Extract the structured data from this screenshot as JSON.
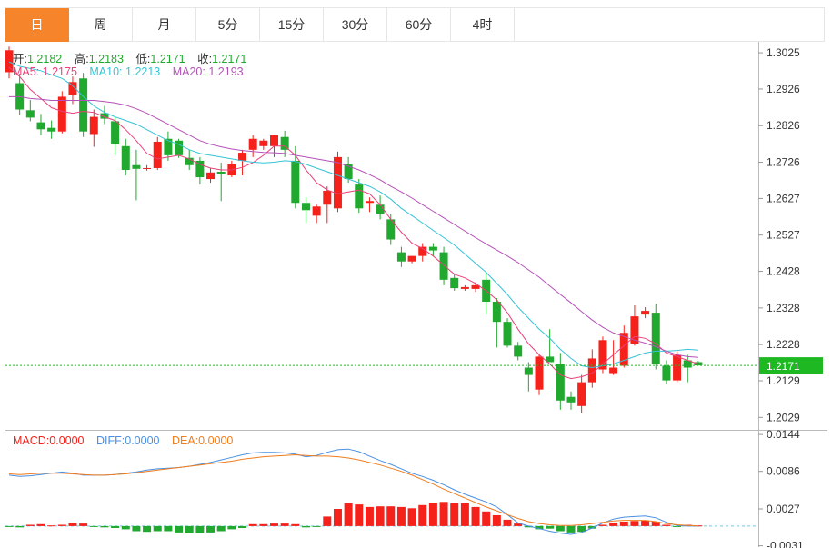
{
  "tabs": [
    "日",
    "周",
    "月",
    "5分",
    "15分",
    "30分",
    "60分",
    "4时"
  ],
  "active_tab": 0,
  "ohlc_info": {
    "open_label": "开:",
    "open": "1.2182",
    "high_label": "高:",
    "high": "1.2183",
    "low_label": "低:",
    "low": "1.2171",
    "close_label": "收:",
    "close": "1.2171"
  },
  "ma_info": {
    "ma5_label": "MA5:",
    "ma5": "1.2175",
    "ma10_label": "MA10:",
    "ma10": "1.2213",
    "ma20_label": "MA20:",
    "ma20": "1.2193"
  },
  "macd_info": {
    "macd_label": "MACD:",
    "macd": "0.0000",
    "diff_label": "DIFF:",
    "diff": "0.0000",
    "dea_label": "DEA:",
    "dea": "0.0000"
  },
  "colors": {
    "up": "#f5211b",
    "down": "#21a82f",
    "ma5": "#e9407a",
    "ma10": "#36c3d6",
    "ma20": "#b451b8",
    "diff": "#4a90e2",
    "dea": "#f07d1e",
    "price_tag": "#1db822",
    "accent": "#f5842b"
  },
  "chart_data": [
    {
      "type": "candlestick",
      "y_ticks": [
        "1.3025",
        "1.2926",
        "1.2826",
        "1.2726",
        "1.2627",
        "1.2527",
        "1.2428",
        "1.2328",
        "1.2228",
        "1.2129",
        "1.2029"
      ],
      "ylim": [
        1.1995,
        1.3055
      ],
      "last_price": "1.2171",
      "candles": [
        [
          1.2972,
          1.3042,
          1.2955,
          1.3032
        ],
        [
          1.2942,
          1.2968,
          1.2855,
          1.287
        ],
        [
          1.2868,
          1.2896,
          1.2838,
          1.2848
        ],
        [
          1.2835,
          1.2858,
          1.28,
          1.2816
        ],
        [
          1.282,
          1.284,
          1.279,
          1.281
        ],
        [
          1.281,
          1.292,
          1.2805,
          1.2905
        ],
        [
          1.291,
          1.296,
          1.2885,
          1.2945
        ],
        [
          1.2955,
          1.297,
          1.2795,
          1.281
        ],
        [
          1.2803,
          1.287,
          1.2768,
          1.285
        ],
        [
          1.286,
          1.288,
          1.283,
          1.2845
        ],
        [
          1.2838,
          1.285,
          1.2745,
          1.2775
        ],
        [
          1.277,
          1.279,
          1.269,
          1.2705
        ],
        [
          1.2718,
          1.276,
          1.2622,
          1.2708
        ],
        [
          1.2708,
          1.2718,
          1.2703,
          1.271
        ],
        [
          1.271,
          1.2795,
          1.2705,
          1.2782
        ],
        [
          1.279,
          1.281,
          1.273,
          1.2745
        ],
        [
          1.2785,
          1.279,
          1.2738,
          1.2745
        ],
        [
          1.2738,
          1.276,
          1.2705,
          1.2718
        ],
        [
          1.273,
          1.274,
          1.2665,
          1.2685
        ],
        [
          1.268,
          1.271,
          1.267,
          1.2698
        ],
        [
          1.27,
          1.2725,
          1.262,
          1.2695
        ],
        [
          1.269,
          1.273,
          1.2685,
          1.272
        ],
        [
          1.273,
          1.276,
          1.269,
          1.2752
        ],
        [
          1.276,
          1.28,
          1.274,
          1.279
        ],
        [
          1.277,
          1.279,
          1.276,
          1.2785
        ],
        [
          1.277,
          1.28,
          1.274,
          1.28
        ],
        [
          1.2795,
          1.2812,
          1.274,
          1.276
        ],
        [
          1.273,
          1.277,
          1.26,
          1.2615
        ],
        [
          1.2615,
          1.263,
          1.256,
          1.2595
        ],
        [
          1.258,
          1.261,
          1.256,
          1.2605
        ],
        [
          1.261,
          1.266,
          1.256,
          1.2648
        ],
        [
          1.26,
          1.2755,
          1.259,
          1.274
        ],
        [
          1.272,
          1.274,
          1.267,
          1.268
        ],
        [
          1.2665,
          1.268,
          1.2588,
          1.26
        ],
        [
          1.2615,
          1.263,
          1.259,
          1.262
        ],
        [
          1.261,
          1.2635,
          1.257,
          1.2585
        ],
        [
          1.257,
          1.2585,
          1.25,
          1.2515
        ],
        [
          1.248,
          1.2495,
          1.244,
          1.2455
        ],
        [
          1.2455,
          1.247,
          1.245,
          1.247
        ],
        [
          1.247,
          1.2505,
          1.2455,
          1.2495
        ],
        [
          1.2495,
          1.2505,
          1.247,
          1.2485
        ],
        [
          1.248,
          1.2495,
          1.239,
          1.2405
        ],
        [
          1.241,
          1.242,
          1.2375,
          1.2382
        ],
        [
          1.238,
          1.239,
          1.2375,
          1.2385
        ],
        [
          1.238,
          1.2398,
          1.2372,
          1.239
        ],
        [
          1.2405,
          1.2425,
          1.231,
          1.2345
        ],
        [
          1.2345,
          1.2355,
          1.222,
          1.229
        ],
        [
          1.229,
          1.23,
          1.222,
          1.2225
        ],
        [
          1.2225,
          1.2235,
          1.2185,
          1.2195
        ],
        [
          1.2165,
          1.218,
          1.21,
          1.2145
        ],
        [
          1.2105,
          1.22,
          1.209,
          1.2195
        ],
        [
          1.2195,
          1.227,
          1.2182,
          1.218
        ],
        [
          1.2175,
          1.2205,
          1.205,
          1.2075
        ],
        [
          1.2085,
          1.21,
          1.205,
          1.207
        ],
        [
          1.206,
          1.2145,
          1.204,
          1.2125
        ],
        [
          1.2125,
          1.2215,
          1.211,
          1.219
        ],
        [
          1.216,
          1.225,
          1.215,
          1.224
        ],
        [
          1.215,
          1.224,
          1.2145,
          1.2165
        ],
        [
          1.217,
          1.228,
          1.2165,
          1.226
        ],
        [
          1.223,
          1.2335,
          1.2225,
          1.2305
        ],
        [
          1.231,
          1.233,
          1.23,
          1.232
        ],
        [
          1.2315,
          1.234,
          1.216,
          1.2175
        ],
        [
          1.217,
          1.2185,
          1.212,
          1.213
        ],
        [
          1.213,
          1.221,
          1.2125,
          1.22
        ],
        [
          1.2185,
          1.22,
          1.2125,
          1.2165
        ],
        [
          1.218,
          1.2183,
          1.2171,
          1.2171
        ]
      ],
      "ma5": [
        1.2985,
        1.296,
        1.2925,
        1.29,
        1.2875,
        1.2865,
        1.286,
        1.2865,
        1.2862,
        1.285,
        1.284,
        1.2815,
        1.2785,
        1.275,
        1.2735,
        1.274,
        1.2745,
        1.2735,
        1.272,
        1.271,
        1.2705,
        1.2705,
        1.2712,
        1.2725,
        1.2745,
        1.277,
        1.277,
        1.2745,
        1.2705,
        1.267,
        1.265,
        1.264,
        1.2645,
        1.265,
        1.264,
        1.261,
        1.257,
        1.2535,
        1.2505,
        1.249,
        1.247,
        1.2445,
        1.242,
        1.241,
        1.2395,
        1.2375,
        1.235,
        1.2315,
        1.227,
        1.223,
        1.22,
        1.2175,
        1.2145,
        1.2135,
        1.214,
        1.215,
        1.2175,
        1.22,
        1.2225,
        1.225,
        1.2245,
        1.223,
        1.2205,
        1.2195,
        1.2185,
        1.2175
      ],
      "ma10": [
        1.3,
        1.2988,
        1.2982,
        1.2976,
        1.2965,
        1.2955,
        1.2935,
        1.2905,
        1.288,
        1.2862,
        1.285,
        1.284,
        1.283,
        1.2815,
        1.28,
        1.2785,
        1.2775,
        1.276,
        1.275,
        1.2745,
        1.274,
        1.2735,
        1.273,
        1.2726,
        1.2724,
        1.2726,
        1.273,
        1.2728,
        1.272,
        1.271,
        1.27,
        1.269,
        1.268,
        1.267,
        1.266,
        1.2645,
        1.2625,
        1.26,
        1.258,
        1.256,
        1.254,
        1.252,
        1.25,
        1.2475,
        1.245,
        1.2425,
        1.2395,
        1.2365,
        1.233,
        1.23,
        1.227,
        1.2245,
        1.2215,
        1.219,
        1.217,
        1.2165,
        1.217,
        1.2175,
        1.2185,
        1.2195,
        1.2205,
        1.221,
        1.221,
        1.2212,
        1.2215,
        1.2213
      ],
      "ma20": [
        1.2905,
        1.2905,
        1.29,
        1.2898,
        1.2895,
        1.2895,
        1.2895,
        1.2895,
        1.2895,
        1.2892,
        1.2888,
        1.2882,
        1.2872,
        1.286,
        1.2845,
        1.283,
        1.2815,
        1.28,
        1.2785,
        1.2775,
        1.2768,
        1.2762,
        1.2758,
        1.2755,
        1.2753,
        1.2752,
        1.275,
        1.2745,
        1.274,
        1.2735,
        1.273,
        1.2725,
        1.2715,
        1.2705,
        1.2692,
        1.2678,
        1.266,
        1.2645,
        1.2628,
        1.261,
        1.2592,
        1.2574,
        1.2556,
        1.2538,
        1.252,
        1.2503,
        1.2486,
        1.247,
        1.2452,
        1.2432,
        1.2412,
        1.2388,
        1.2365,
        1.2342,
        1.2318,
        1.2295,
        1.2275,
        1.226,
        1.225,
        1.224,
        1.2232,
        1.2222,
        1.221,
        1.22,
        1.2195,
        1.2193
      ]
    },
    {
      "type": "macd",
      "y_ticks": [
        "0.0144",
        "0.0086",
        "0.0027",
        "-0.0031"
      ],
      "ylim": [
        -0.0033,
        0.0147
      ],
      "diff": [
        0.008,
        0.0078,
        0.0079,
        0.0081,
        0.0083,
        0.0085,
        0.0083,
        0.008,
        0.008,
        0.008,
        0.0081,
        0.0083,
        0.0085,
        0.0088,
        0.009,
        0.0091,
        0.0092,
        0.0094,
        0.0097,
        0.01,
        0.0104,
        0.0108,
        0.0112,
        0.0115,
        0.0116,
        0.0116,
        0.0115,
        0.0113,
        0.0109,
        0.0111,
        0.0116,
        0.012,
        0.0121,
        0.0117,
        0.011,
        0.0103,
        0.0097,
        0.009,
        0.0083,
        0.0078,
        0.0072,
        0.0065,
        0.0057,
        0.005,
        0.0044,
        0.0038,
        0.003,
        0.0018,
        0.0005,
        0.0,
        -0.0004,
        -0.0008,
        -0.0011,
        -0.0013,
        -0.001,
        -0.0003,
        0.0005,
        0.0011,
        0.0014,
        0.0015,
        0.0016,
        0.0013,
        0.0006,
        0.0001,
        0.0,
        0.0
      ],
      "dea": [
        0.0082,
        0.0081,
        0.0082,
        0.0083,
        0.0083,
        0.0083,
        0.0082,
        0.0081,
        0.008,
        0.008,
        0.0081,
        0.0082,
        0.0084,
        0.0086,
        0.0088,
        0.009,
        0.0092,
        0.0094,
        0.0096,
        0.0098,
        0.01,
        0.0102,
        0.0105,
        0.0107,
        0.0109,
        0.011,
        0.0111,
        0.0112,
        0.0111,
        0.011,
        0.011,
        0.0109,
        0.0107,
        0.0104,
        0.01,
        0.0096,
        0.0091,
        0.0086,
        0.008,
        0.0073,
        0.0066,
        0.0058,
        0.0051,
        0.0044,
        0.0037,
        0.003,
        0.0024,
        0.0018,
        0.0012,
        0.0007,
        0.0004,
        0.0002,
        0.0001,
        0.0001,
        0.0002,
        0.0004,
        0.0006,
        0.0008,
        0.0009,
        0.0009,
        0.0009,
        0.0007,
        0.0004,
        0.0002,
        0.0001,
        0.0
      ],
      "macd": [
        -0.0001,
        -0.0002,
        0.0002,
        0.0003,
        0.0001,
        0.0002,
        0.0005,
        0.0004,
        -0.0001,
        -0.0002,
        -0.0003,
        -0.0005,
        -0.0008,
        -0.0009,
        -0.0008,
        -0.0008,
        -0.001,
        -0.0011,
        -0.0011,
        -0.001,
        -0.0008,
        -0.0005,
        -0.0003,
        0.0003,
        0.0003,
        0.0004,
        0.0004,
        0.0003,
        -0.0002,
        -0.0001,
        0.0015,
        0.0027,
        0.0036,
        0.0034,
        0.003,
        0.0031,
        0.0031,
        0.003,
        0.0028,
        0.0033,
        0.0037,
        0.0038,
        0.0036,
        0.0036,
        0.003,
        0.0023,
        0.0017,
        0.001,
        0.0004,
        -0.0002,
        -0.0005,
        -0.0004,
        -0.0008,
        -0.001,
        -0.0009,
        -0.0004,
        0.0002,
        0.0005,
        0.0007,
        0.0008,
        0.0009,
        0.0007,
        0.0002,
        -0.0001,
        0.0002,
        0.0001
      ]
    }
  ]
}
